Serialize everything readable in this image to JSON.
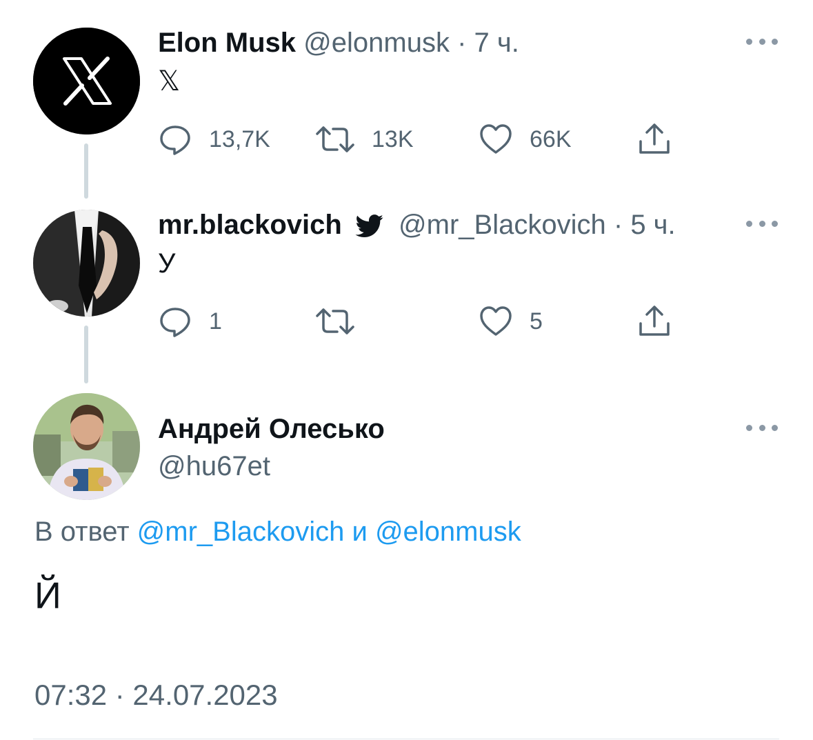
{
  "tweets": [
    {
      "name": "Elon Musk",
      "handle": "@elonmusk",
      "separator": "·",
      "time": "7 ч.",
      "text": "𝕏",
      "reply_count": "13,7K",
      "retweet_count": "13K",
      "like_count": "66K"
    },
    {
      "name": "mr.blackovich",
      "handle": "@mr_Blackovich",
      "separator": "·",
      "time": "5 ч.",
      "text": "У",
      "reply_count": "1",
      "retweet_count": "",
      "like_count": "5"
    }
  ],
  "main_tweet": {
    "name": "Андрей Олесько",
    "handle": "@hu67et",
    "reply_prefix": "В ответ",
    "reply_mention_1": "@mr_Blackovich",
    "reply_and": "и",
    "reply_mention_2": "@elonmusk",
    "text": "Й",
    "timestamp": "07:32 · 24.07.2023"
  },
  "colors": {
    "text_primary": "#0f1419",
    "text_secondary": "#536471",
    "link": "#1d9bf0",
    "thread_line": "#cfd9de"
  },
  "icons": [
    "x-logo-icon",
    "verified-bird-icon",
    "reply-icon",
    "retweet-icon",
    "like-icon",
    "share-icon",
    "more-icon"
  ]
}
